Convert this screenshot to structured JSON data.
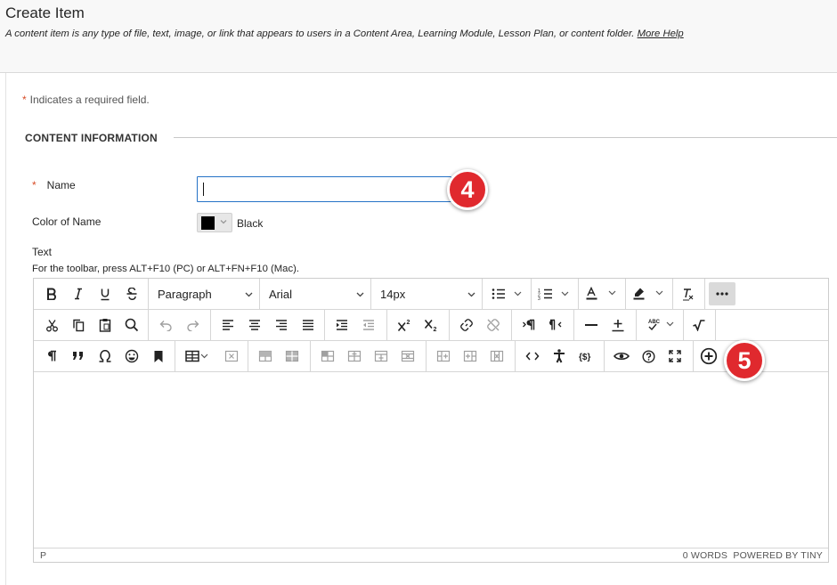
{
  "page": {
    "title": "Create Item",
    "description": "A content item is any type of file, text, image, or link that appears to users in a Content Area, Learning Module, Lesson Plan, or content folder.",
    "more_help": "More Help"
  },
  "form": {
    "required_marker": "*",
    "required_note": "Indicates a required field.",
    "section_title": "CONTENT INFORMATION",
    "name_label": "Name",
    "name_value": "",
    "color_label": "Color of Name",
    "color_value": "Black",
    "text_label": "Text",
    "toolbar_hint": "For the toolbar, press ALT+F10 (PC) or ALT+FN+F10 (Mac)."
  },
  "editor": {
    "block_format": "Paragraph",
    "font_family": "Arial",
    "font_size": "14px",
    "status_path": "P",
    "word_count": "0 WORDS",
    "powered_by": "POWERED BY TINY"
  },
  "callouts": [
    "4",
    "5"
  ],
  "colors": {
    "accent": "#2572c6",
    "required": "#d84c27",
    "callout": "#e0292e"
  }
}
